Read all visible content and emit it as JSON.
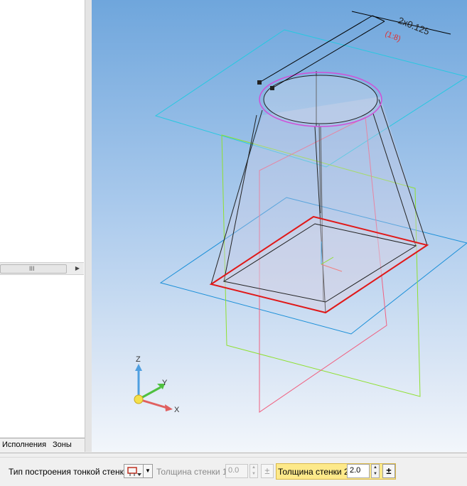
{
  "tree_panel": {
    "hscroll_grip": "III",
    "hscroll_arrow": "▶",
    "tabs": [
      "Исполнения",
      "Зоны"
    ]
  },
  "viewport": {
    "dimension_text": "2x0.125",
    "dimension_subtext": "(1:8)",
    "axis_labels": {
      "x": "X",
      "y": "Y",
      "z": "Z"
    },
    "colors": {
      "pink_circle": "#d050d8",
      "red_base": "#e01818",
      "cyan_plane": "#27c8e0",
      "blue_plane": "#1a8fd8",
      "green_plane": "#8fe030"
    }
  },
  "property_bar": {
    "wall_type_label": "Тип построения тонкой стенки",
    "wall_type_icon": "wall-type-icon",
    "wall_type_dropdown": "▼",
    "thickness1_label": "Толщина стенки 1",
    "thickness1_value": "0.0",
    "thickness1_sign": "±",
    "thickness2_label": "Толщина стенки 2",
    "thickness2_value": "2.0",
    "thickness2_sign": "±",
    "spin_up": "▲",
    "spin_down": "▼"
  }
}
